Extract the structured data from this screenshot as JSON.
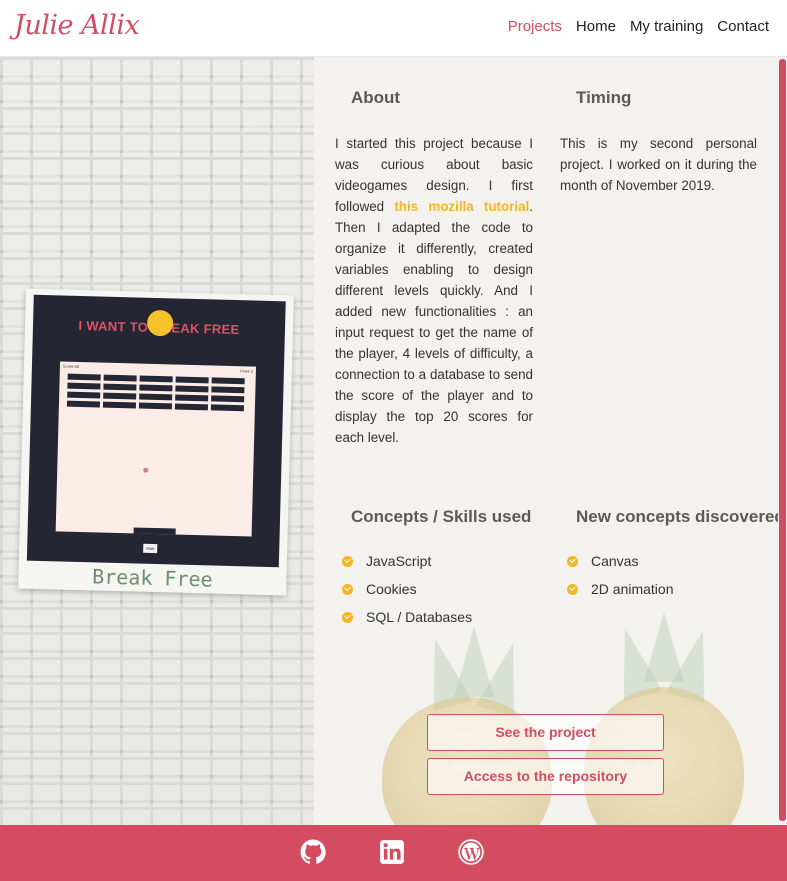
{
  "header": {
    "logo": "Julie Allix",
    "nav": [
      "Projects",
      "Home",
      "My training",
      "Contact"
    ]
  },
  "project": {
    "game_title": "I WANT TO BREAK FREE",
    "score_label": "Score 60",
    "lives_label": "Lives 3",
    "start_label": "Start",
    "caption": "Break Free"
  },
  "about": {
    "title": "About",
    "text_before": "I started this project because I was curious about basic videogames design. I first followed ",
    "link": "this mozilla tutorial",
    "text_after": ". Then I adapted the code to organize it differently, created variables enabling to design different levels quickly. And I added new functionalities : an input request to get the name of the player, 4 levels of difficulty, a connection to a database to send the score of the player and to display the top 20 scores for each level."
  },
  "timing": {
    "title": "Timing",
    "text": "This is my second personal project. I worked on it during the month of November 2019."
  },
  "skills": {
    "title": "Concepts / Skills used",
    "items": [
      "JavaScript",
      "Cookies",
      "SQL / Databases"
    ]
  },
  "new_concepts": {
    "title": "New concepts discovered",
    "items": [
      "Canvas",
      "2D animation"
    ]
  },
  "buttons": {
    "see_project": "See the project",
    "repository": "Access to the repository"
  },
  "footer": {
    "icons": [
      "github-icon",
      "linkedin-icon",
      "wordpress-icon"
    ]
  },
  "colors": {
    "accent": "#d14d61",
    "highlight": "#f2b626",
    "footer": "#d44c60"
  }
}
